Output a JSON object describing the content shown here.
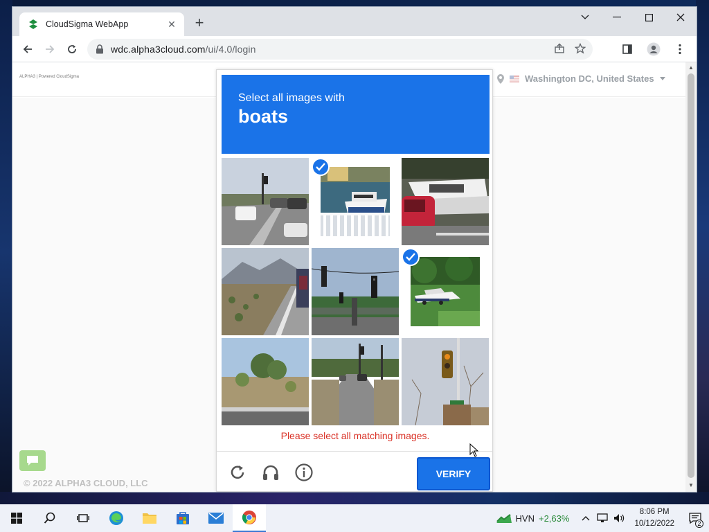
{
  "browser": {
    "tab_title": "CloudSigma WebApp",
    "url_host": "wdc.alpha3cloud.com",
    "url_path": "/ui/4.0/login"
  },
  "page": {
    "logo_text": "ALPHA3 | Powered CloudSigma",
    "location": "Washington DC, United States",
    "copyright": "© 2022 ALPHA3 CLOUD, LLC"
  },
  "captcha": {
    "instruction": "Select all images with",
    "target": "boats",
    "error": "Please select all matching images.",
    "verify_label": "VERIFY",
    "tiles": [
      {
        "subject": "street intersection with cars",
        "selected": false
      },
      {
        "subject": "boat at pier",
        "selected": true
      },
      {
        "subject": "boat on trailer behind car",
        "selected": false
      },
      {
        "subject": "desert highway with truck",
        "selected": false
      },
      {
        "subject": "traffic lights over road",
        "selected": false
      },
      {
        "subject": "boat on trailer in grass",
        "selected": true
      },
      {
        "subject": "trees by roadside",
        "selected": false
      },
      {
        "subject": "suburban street with cars",
        "selected": false
      },
      {
        "subject": "traffic light on pole",
        "selected": false
      }
    ]
  },
  "taskbar": {
    "stock_name": "HVN",
    "stock_change": "+2,63%",
    "time": "8:06 PM",
    "date": "10/12/2022",
    "notifications": "2"
  },
  "colors": {
    "accent": "#1a73e8",
    "error": "#d93025",
    "favicon": "#1e8e3e"
  }
}
